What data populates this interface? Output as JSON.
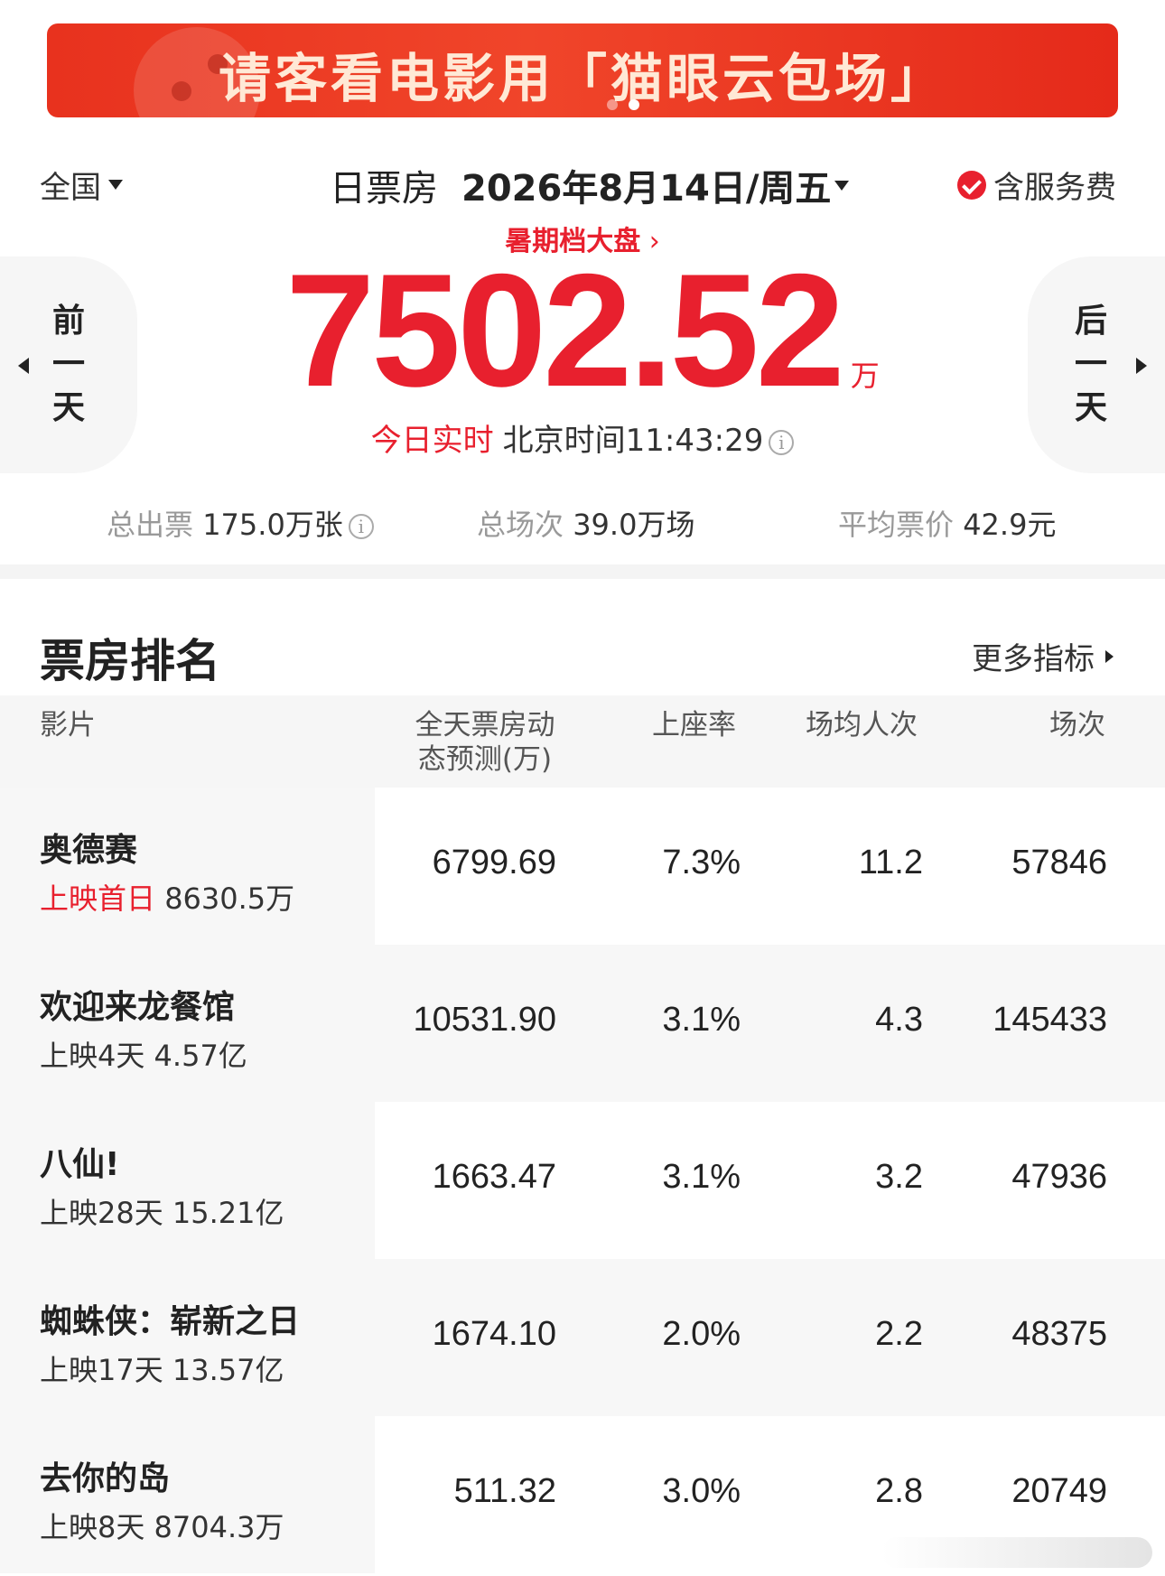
{
  "banner": {
    "text": "请客看电影用「猫眼云包场」"
  },
  "header": {
    "region": "全国",
    "title": "日票房",
    "date": "2026年8月14日/周五",
    "fee_label": "含服务费"
  },
  "season_link": "暑期档大盘",
  "total": {
    "value": "7502.52",
    "unit": "万"
  },
  "realtime": {
    "label": "今日实时",
    "time_text": "北京时间11:43:29"
  },
  "nav": {
    "prev": [
      "前",
      "一",
      "天"
    ],
    "next": [
      "后",
      "一",
      "天"
    ]
  },
  "stats": {
    "tickets_label": "总出票",
    "tickets_value": "175.0万张",
    "shows_label": "总场次",
    "shows_value": "39.0万场",
    "price_label": "平均票价",
    "price_value": "42.9元"
  },
  "ranking": {
    "title": "票房排名",
    "more": "更多指标",
    "headers": {
      "film": "影片",
      "forecast_line1": "全天票房动",
      "forecast_line2": "态预测(万)",
      "occupancy": "上座率",
      "avg_people": "场均人次",
      "shows": "场次"
    },
    "rows": [
      {
        "title": "奥德赛",
        "release": "上映首日",
        "total": "8630.5万",
        "forecast": "6799.69",
        "occupancy": "7.3%",
        "avg": "11.2",
        "shows": "57846"
      },
      {
        "title": "欢迎来龙餐馆",
        "release": "上映4天",
        "total": "4.57亿",
        "forecast": "10531.90",
        "occupancy": "3.1%",
        "avg": "4.3",
        "shows": "145433"
      },
      {
        "title": "八仙!",
        "release": "上映28天",
        "total": "15.21亿",
        "forecast": "1663.47",
        "occupancy": "3.1%",
        "avg": "3.2",
        "shows": "47936"
      },
      {
        "title": "蜘蛛侠：崭新之日",
        "release": "上映17天",
        "total": "13.57亿",
        "forecast": "1674.10",
        "occupancy": "2.0%",
        "avg": "2.2",
        "shows": "48375"
      },
      {
        "title": "去你的岛",
        "release": "上映8天",
        "total": "8704.3万",
        "forecast": "511.32",
        "occupancy": "3.0%",
        "avg": "2.8",
        "shows": "20749"
      }
    ]
  }
}
